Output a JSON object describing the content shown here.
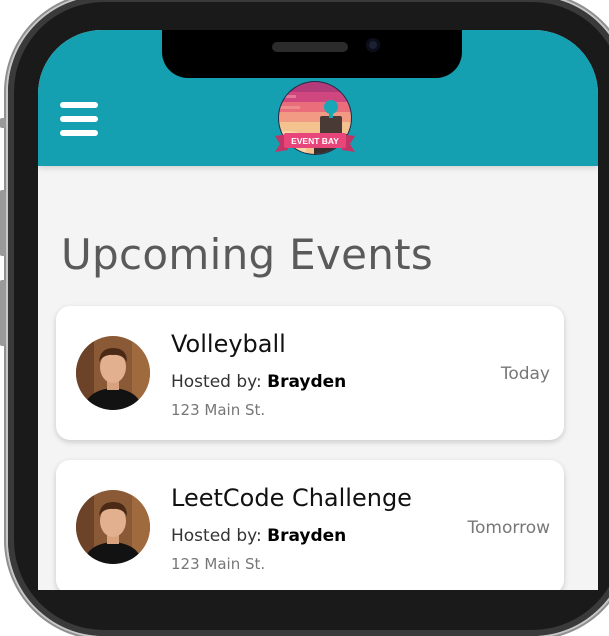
{
  "app": {
    "logo_text": "EVENT BAY"
  },
  "page": {
    "title": "Upcoming Events"
  },
  "events": [
    {
      "title": "Volleyball",
      "host_prefix": "Hosted by: ",
      "host_name": "Brayden",
      "address": "123 Main St.",
      "date": "Today"
    },
    {
      "title": "LeetCode Challenge",
      "host_prefix": "Hosted by: ",
      "host_name": "Brayden",
      "address": "123 Main St.",
      "date": "Tomorrow"
    }
  ],
  "colors": {
    "header": "#14a0b0",
    "background": "#f4f4f4",
    "card": "#ffffff",
    "logo_banner": "#e8457a"
  },
  "icons": {
    "menu": "hamburger-menu-icon"
  }
}
